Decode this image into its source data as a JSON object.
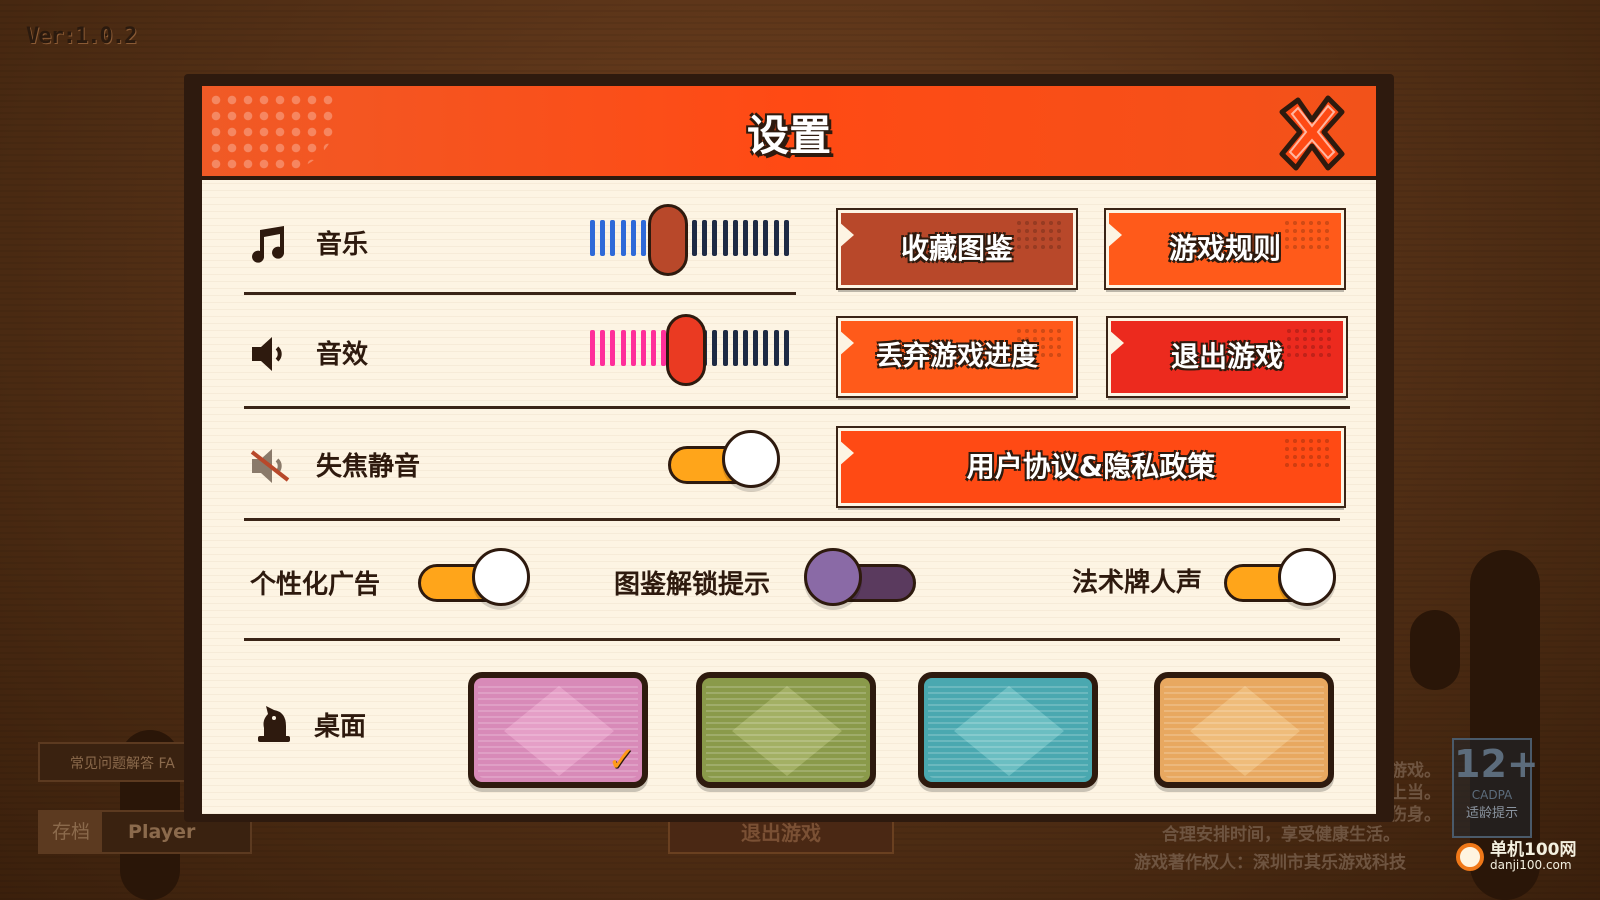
{
  "version": "Ver:1.0.2",
  "background": {
    "faq_label": "常见问题解答 FA",
    "save_tag": "存档",
    "player_name": "Player",
    "exit_label": "退出游戏",
    "notice_lines": [
      "游戏。",
      "上当。",
      "伤身。",
      "合理安排时间，享受健康生活。",
      "游戏著作权人：深圳市其乐游戏科技"
    ],
    "age_rating": "12+",
    "age_org": "CADPA",
    "age_label": "适龄提示",
    "watermark_main": "单机100网",
    "watermark_sub": "danji100.com"
  },
  "settings": {
    "title": "设置",
    "music": {
      "label": "音乐",
      "level": 0.38,
      "fill_color": "#2f6ad8",
      "knob_color": "#b8482a"
    },
    "sfx": {
      "label": "音效",
      "level": 0.47,
      "fill_color": "#ff2f9a",
      "knob_color": "#ea3a22"
    },
    "focus_mute": {
      "label": "失焦静音",
      "on": true
    },
    "personal_ads": {
      "label": "个性化广告",
      "on": true
    },
    "codex_hint": {
      "label": "图鉴解锁提示",
      "on": false
    },
    "spell_voice": {
      "label": "法术牌人声",
      "on": true
    },
    "table": {
      "label": "桌面",
      "selected": 0
    },
    "buttons": {
      "codex": "收藏图鉴",
      "rules": "游戏规则",
      "abandon": "丢弃游戏进度",
      "quit": "退出游戏",
      "agreement": "用户协议&隐私政策"
    }
  },
  "colors": {
    "header": "#ff4a14",
    "toggle_on": "#ffa51a",
    "toggle_off_track": "#5a3a5e",
    "toggle_off_thumb": "#8a6aa6",
    "button_brown": "#b8482a",
    "button_orange": "#ff5a1a",
    "button_red": "#ec2a1e"
  }
}
